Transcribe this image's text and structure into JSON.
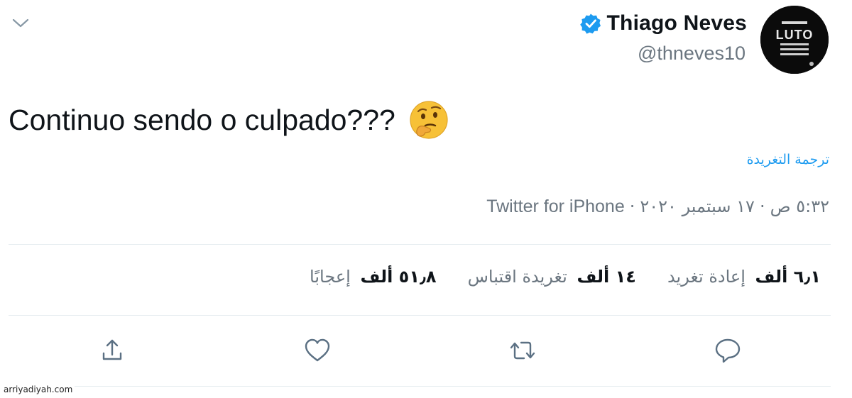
{
  "author": {
    "display_name": "Thiago Neves",
    "handle": "@thneves10",
    "verified": true,
    "avatar_text": "LUTO"
  },
  "tweet": {
    "text": "Continuo sendo o culpado???",
    "emoji": "thinking-face-icon",
    "translate_label": "ترجمة التغريدة"
  },
  "meta": {
    "time": "٥:٣٢ ص",
    "separator": "·",
    "date": "١٧ سبتمبر ٢٠٢٠",
    "source": "Twitter for iPhone"
  },
  "stats": {
    "retweets": {
      "value": "٦٫١ ألف",
      "label": "إعادة تغريد"
    },
    "quote_tweets": {
      "value": "١٤ ألف",
      "label": "تغريدة اقتباس"
    },
    "likes": {
      "value": "٥١٫٨ ألف",
      "label": "إعجابًا"
    }
  },
  "actions": {
    "reply": "reply-icon",
    "retweet": "retweet-icon",
    "like": "heart-icon",
    "share": "share-icon"
  },
  "colors": {
    "accent": "#1d9bf0",
    "text_primary": "#0f1419",
    "text_secondary": "#6b7680",
    "icon": "#5b7083",
    "divider": "#e6ecf0"
  },
  "watermark": "arriyadiyah.com"
}
